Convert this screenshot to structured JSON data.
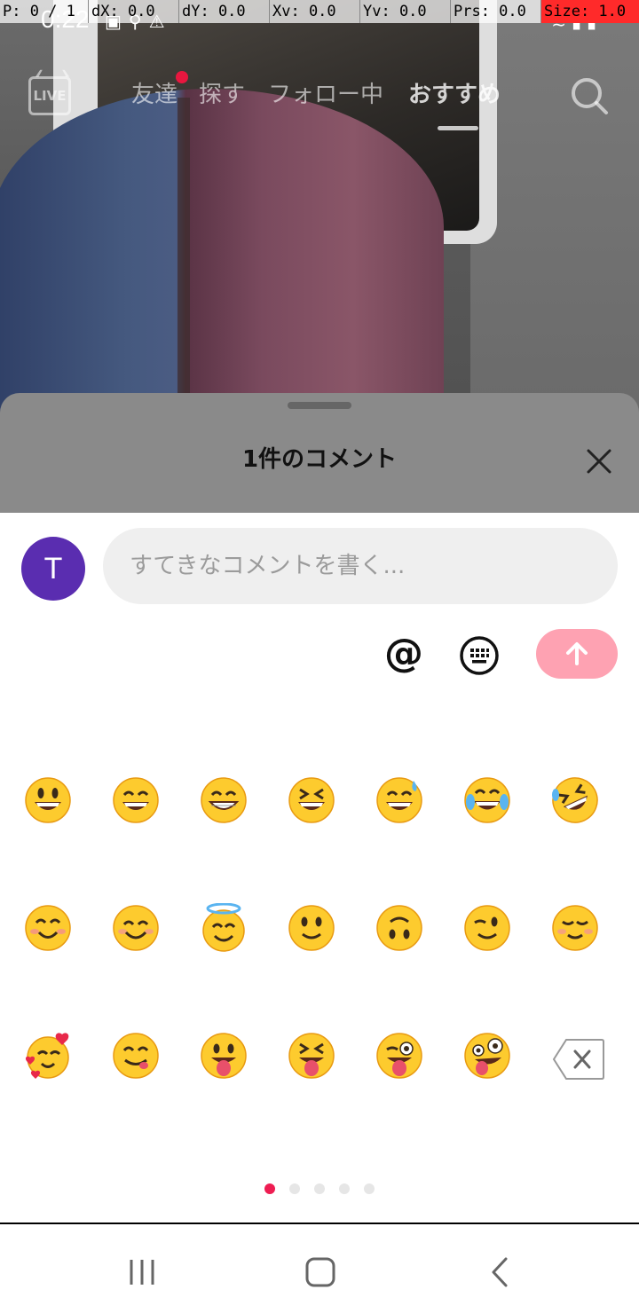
{
  "debug_overlay": {
    "pointer": "P: 0 / 1",
    "dx": "dX: 0.0",
    "dy": "dY: 0.0",
    "xv": "Xv: 0.0",
    "yv": "Yv: 0.0",
    "prs": "Prs: 0.0",
    "size": "Size: 1.0"
  },
  "statusbar": {
    "time": "0:22",
    "icons_left": [
      "gallery-icon",
      "usb-icon",
      "warning-icon"
    ],
    "icons_right": [
      "wifi-icon",
      "signal-icon",
      "battery-icon"
    ]
  },
  "topnav": {
    "live_label": "LIVE",
    "tabs": [
      {
        "label": "友達",
        "has_notification": true
      },
      {
        "label": "探す"
      },
      {
        "label": "フォロー中"
      },
      {
        "label": "おすすめ",
        "active": true
      }
    ]
  },
  "comments": {
    "title": "1件のコメント",
    "input_placeholder": "すてきなコメントを書く...",
    "avatar_initial": "T",
    "mention_label": "@",
    "colors": {
      "accent": "#ee1d52",
      "send_button": "#fea2b2",
      "avatar": "#5a2db0"
    }
  },
  "emoji_panel": {
    "rows": [
      [
        "grinning-big-eyes",
        "grinning-smiling-eyes",
        "beaming-grin",
        "grinning-squinting",
        "grinning-sweat",
        "tears-of-joy",
        "rolling-on-floor-laughing"
      ],
      [
        "smiling-blush",
        "smiling-eyes",
        "halo",
        "slightly-smiling",
        "upside-down",
        "winking",
        "relieved"
      ],
      [
        "hearts",
        "savoring-food",
        "tongue-out",
        "squinting-tongue",
        "winking-tongue",
        "zany"
      ]
    ],
    "page_count": 5,
    "active_page": 1
  },
  "navbar": {
    "buttons": [
      "recent-apps-icon",
      "home-icon",
      "back-icon"
    ]
  }
}
